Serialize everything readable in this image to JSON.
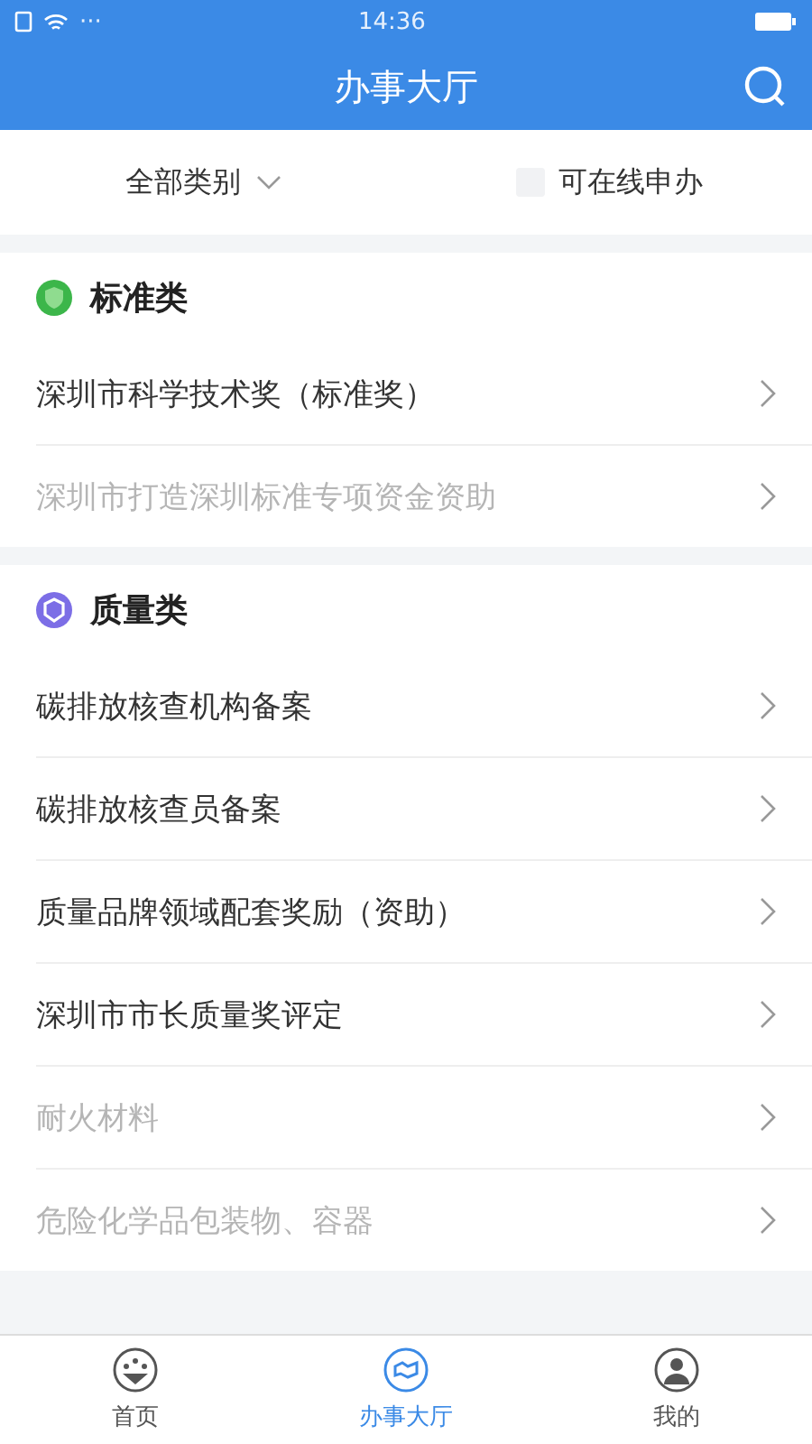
{
  "status_bar": {
    "time": "14:36",
    "dots": "···"
  },
  "header": {
    "title": "办事大厅"
  },
  "filter": {
    "category": "全部类别",
    "online": {
      "label": "可在线申办",
      "checked": false
    }
  },
  "sections": [
    {
      "title": "标准类",
      "kind": "standard",
      "items": [
        {
          "label": "深圳市科学技术奖（标准奖）",
          "disabled": false
        },
        {
          "label": "深圳市打造深圳标准专项资金资助",
          "disabled": true
        }
      ]
    },
    {
      "title": "质量类",
      "kind": "quality",
      "items": [
        {
          "label": "碳排放核查机构备案",
          "disabled": false
        },
        {
          "label": "碳排放核查员备案",
          "disabled": false
        },
        {
          "label": "质量品牌领域配套奖励（资助）",
          "disabled": false
        },
        {
          "label": "深圳市市长质量奖评定",
          "disabled": false
        },
        {
          "label": "耐火材料",
          "disabled": true
        },
        {
          "label": "危险化学品包装物、容器",
          "disabled": true
        }
      ]
    }
  ],
  "tabs": [
    {
      "label": "首页",
      "kind": "home",
      "selected": false
    },
    {
      "label": "办事大厅",
      "kind": "hall",
      "selected": true
    },
    {
      "label": "我的",
      "kind": "me",
      "selected": false
    }
  ]
}
